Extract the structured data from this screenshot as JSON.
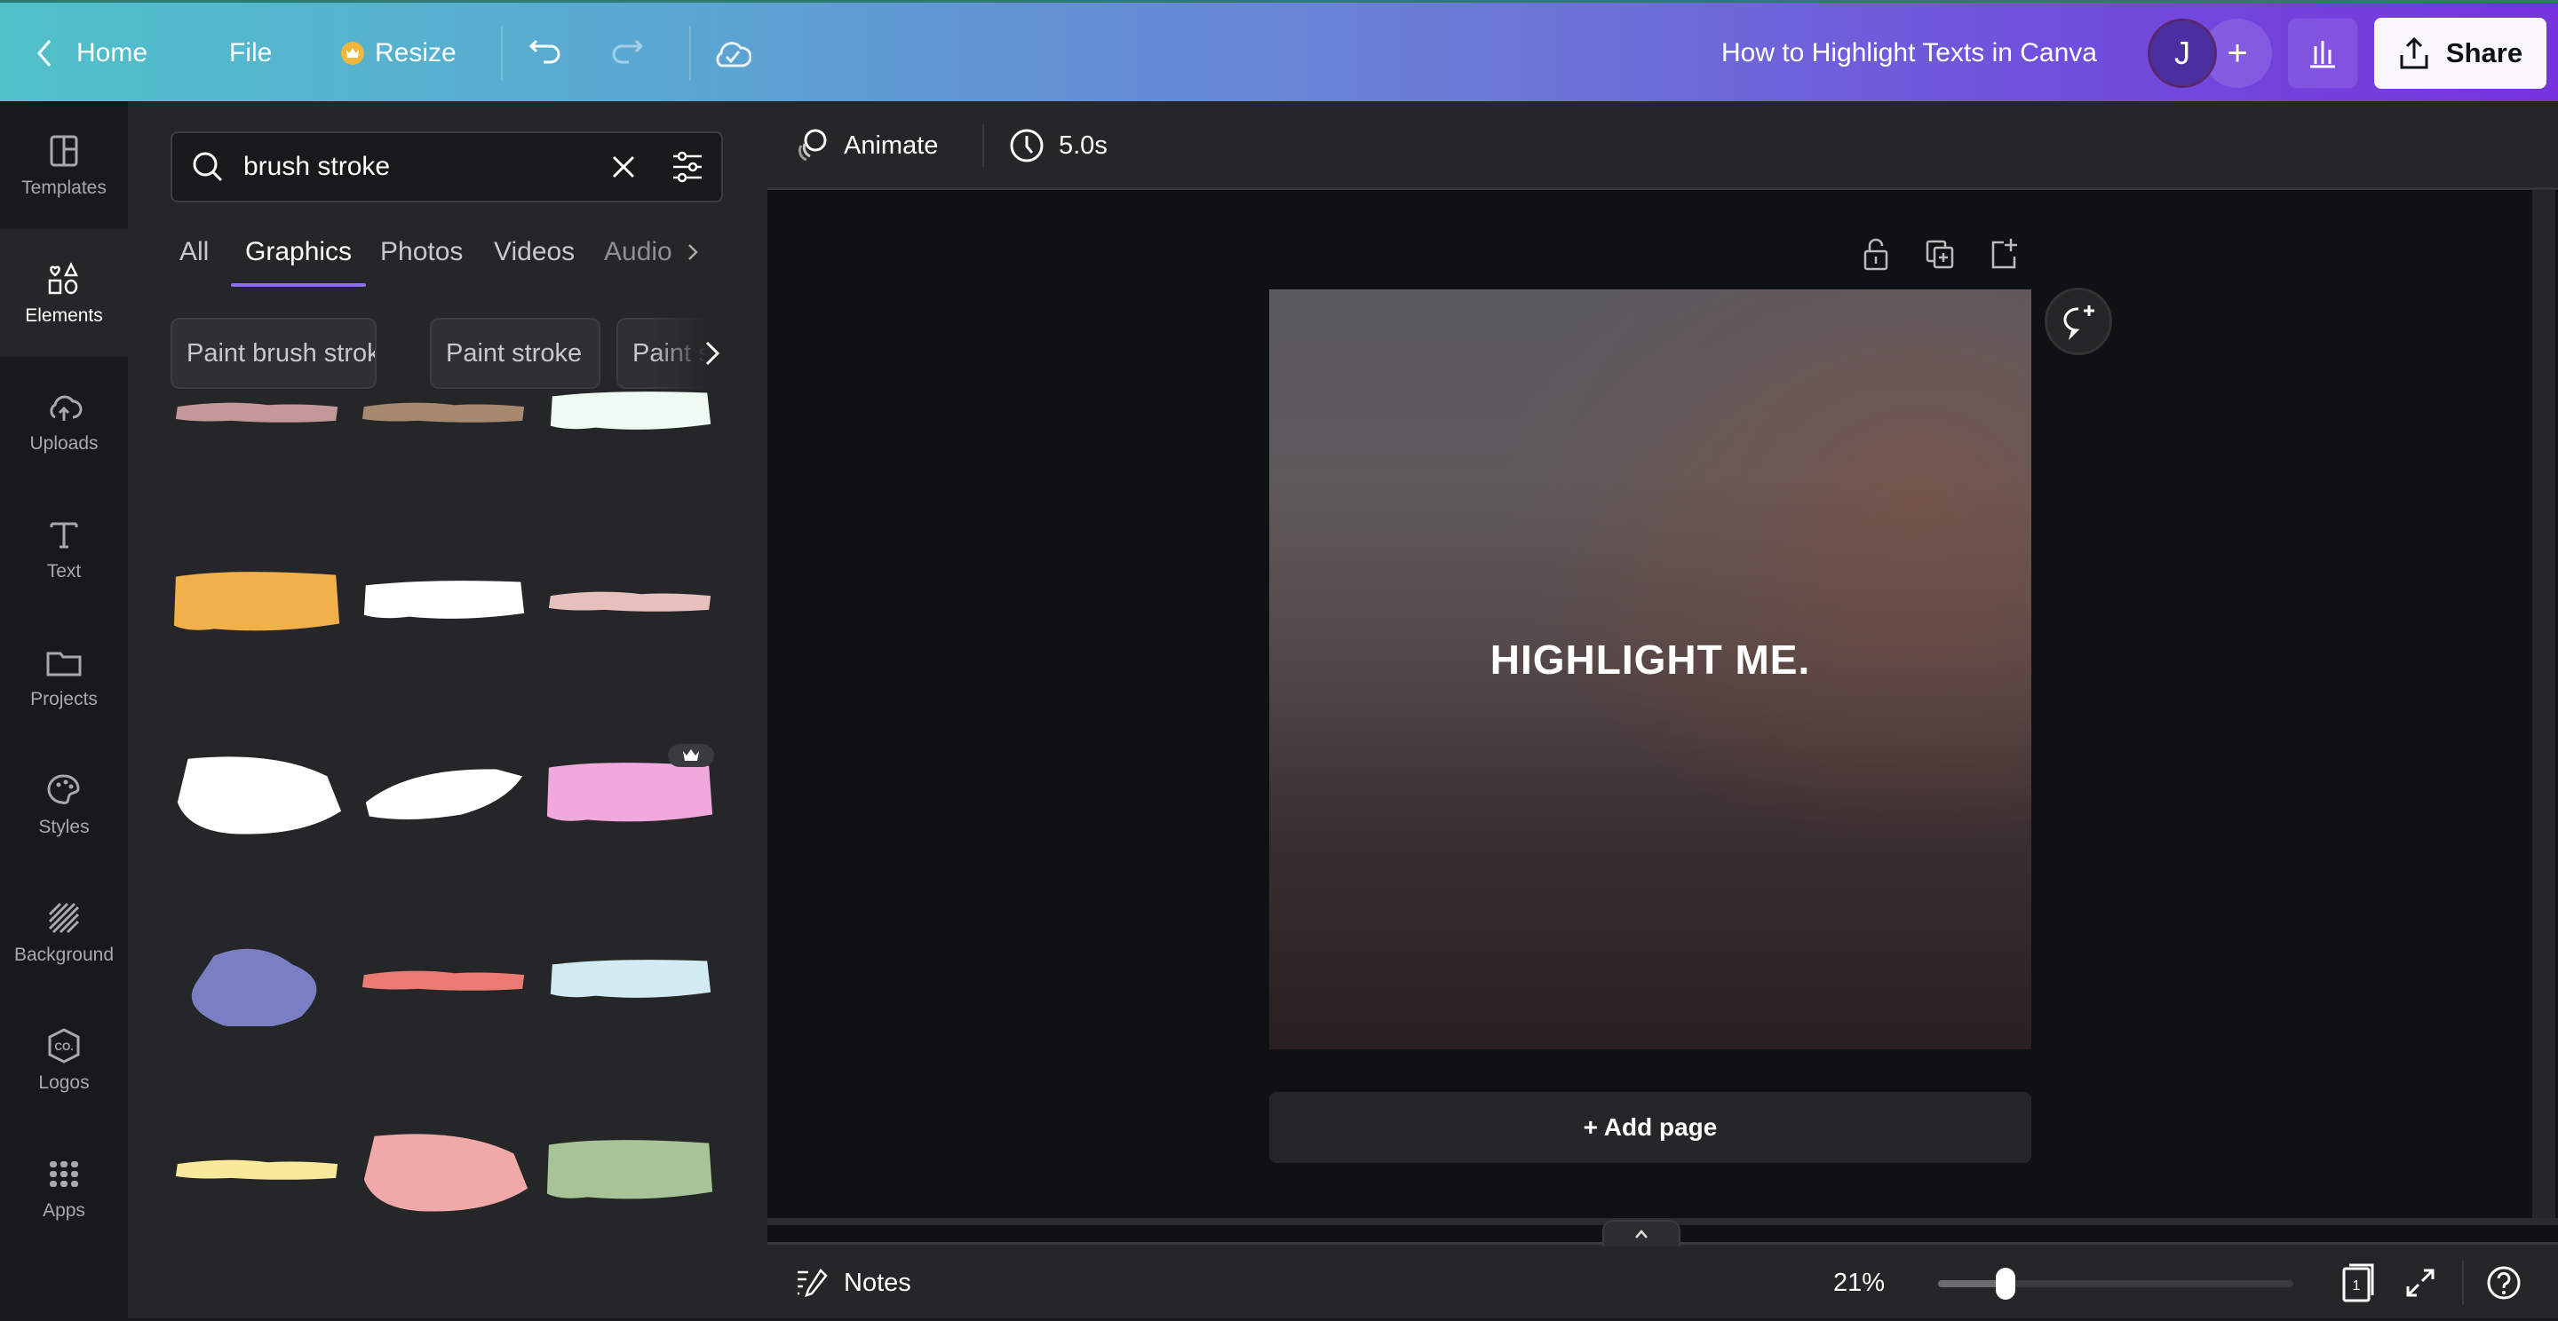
{
  "topbar": {
    "home_label": "Home",
    "file_label": "File",
    "resize_label": "Resize",
    "doc_title": "How to Highlight Texts in Canva",
    "avatar_initial": "J",
    "share_label": "Share"
  },
  "rail": {
    "items": [
      {
        "label": "Templates",
        "icon": "templates-icon"
      },
      {
        "label": "Elements",
        "icon": "elements-icon",
        "active": true
      },
      {
        "label": "Uploads",
        "icon": "upload-icon"
      },
      {
        "label": "Text",
        "icon": "text-icon"
      },
      {
        "label": "Projects",
        "icon": "folder-icon"
      },
      {
        "label": "Styles",
        "icon": "palette-icon"
      },
      {
        "label": "Background",
        "icon": "background-icon"
      },
      {
        "label": "Logos",
        "icon": "logo-icon"
      },
      {
        "label": "Apps",
        "icon": "apps-icon"
      }
    ]
  },
  "panel": {
    "search_value": "brush stroke",
    "tabs": [
      {
        "label": "All"
      },
      {
        "label": "Graphics",
        "active": true
      },
      {
        "label": "Photos"
      },
      {
        "label": "Videos"
      },
      {
        "label": "Audio"
      }
    ],
    "chips": [
      {
        "label": "Paint brush stroke"
      },
      {
        "label": "Paint stroke"
      },
      {
        "label": "Paint splash"
      }
    ],
    "results": [
      {
        "color": "#c4989a",
        "shape": "thin"
      },
      {
        "color": "#a58a70",
        "shape": "thin"
      },
      {
        "color": "#eefaf2",
        "shape": "medium"
      },
      {
        "color": "#f0b04a",
        "shape": "thick"
      },
      {
        "color": "#ffffff",
        "shape": "medium"
      },
      {
        "color": "#e6c0bd",
        "shape": "thin",
        "premium": true
      },
      {
        "color": "#ffffff",
        "shape": "scribble"
      },
      {
        "color": "#ffffff",
        "shape": "swoosh"
      },
      {
        "color": "#f0a8dd",
        "shape": "thick"
      },
      {
        "color": "#8a8fe0",
        "shape": "smoke"
      },
      {
        "color": "#ea7a72",
        "shape": "thin"
      },
      {
        "color": "#d2eaf2",
        "shape": "medium"
      },
      {
        "color": "#f8ea9a",
        "shape": "thin"
      },
      {
        "color": "#f0a8a8",
        "shape": "scribble"
      },
      {
        "color": "#a8c496",
        "shape": "thick"
      }
    ]
  },
  "toolbar": {
    "animate_label": "Animate",
    "duration_label": "5.0s"
  },
  "canvas": {
    "text": "HIGHLIGHT ME.",
    "add_page_label": "+ Add page"
  },
  "bottombar": {
    "notes_label": "Notes",
    "zoom_label": "21%",
    "zoom_fraction": 0.21,
    "page_count": "1"
  }
}
